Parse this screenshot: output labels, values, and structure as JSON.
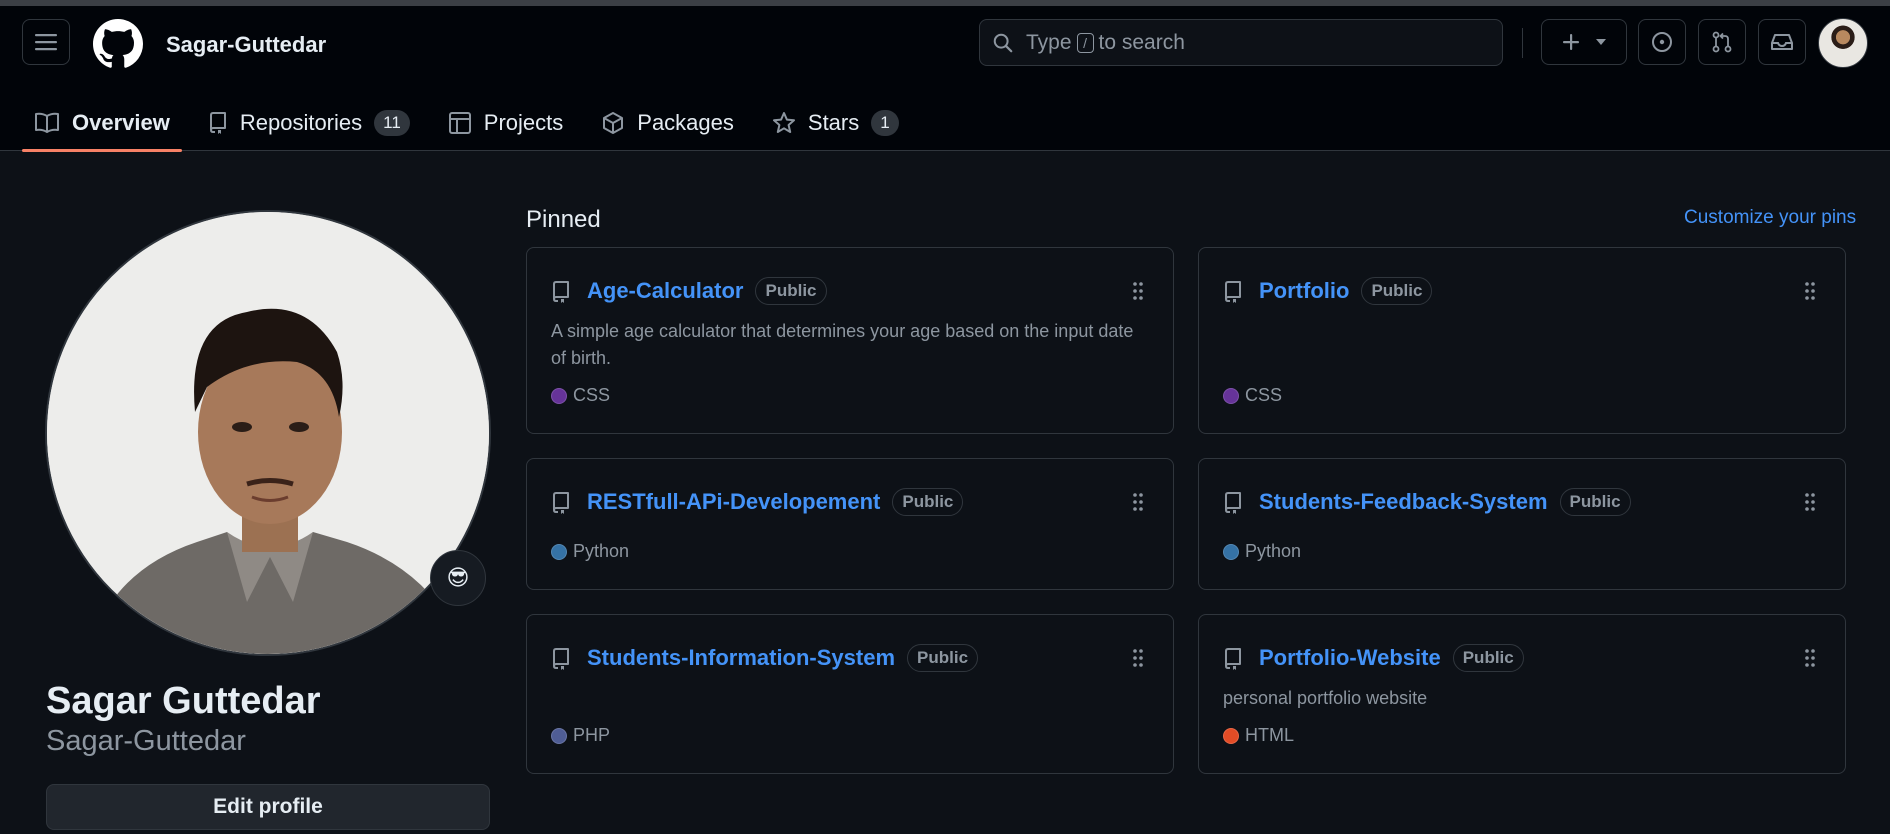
{
  "header": {
    "username": "Sagar-Guttedar",
    "search_prefix": "Type",
    "search_key": "/",
    "search_suffix": "to search"
  },
  "tabs": [
    {
      "label": "Overview",
      "icon": "book-icon",
      "active": true
    },
    {
      "label": "Repositories",
      "count": "11",
      "icon": "repo-icon"
    },
    {
      "label": "Projects",
      "icon": "table-icon"
    },
    {
      "label": "Packages",
      "icon": "package-icon"
    },
    {
      "label": "Stars",
      "count": "1",
      "icon": "star-icon"
    }
  ],
  "profile": {
    "full_name": "Sagar Guttedar",
    "login": "Sagar-Guttedar",
    "edit_label": "Edit profile",
    "status_emoji": "😎"
  },
  "pinned": {
    "title": "Pinned",
    "customize_label": "Customize your pins",
    "repos": [
      {
        "name": "Age-Calculator",
        "visibility": "Public",
        "description": "A simple age calculator that determines your age based on the input date of birth.",
        "language": "CSS",
        "lang_color": "#663399"
      },
      {
        "name": "Portfolio",
        "visibility": "Public",
        "description": "",
        "language": "CSS",
        "lang_color": "#663399"
      },
      {
        "name": "RESTfull-APi-Developement",
        "visibility": "Public",
        "description": "",
        "language": "Python",
        "lang_color": "#3572A5"
      },
      {
        "name": "Students-Feedback-System",
        "visibility": "Public",
        "description": "",
        "language": "Python",
        "lang_color": "#3572A5"
      },
      {
        "name": "Students-Information-System",
        "visibility": "Public",
        "description": "",
        "language": "PHP",
        "lang_color": "#4F5D95"
      },
      {
        "name": "Portfolio-Website",
        "visibility": "Public",
        "description": "personal portfolio website",
        "language": "HTML",
        "lang_color": "#e34c26"
      }
    ]
  },
  "colors": {
    "accent": "#4493f8",
    "tab_underline": "#f78166",
    "background": "#0d1117"
  }
}
